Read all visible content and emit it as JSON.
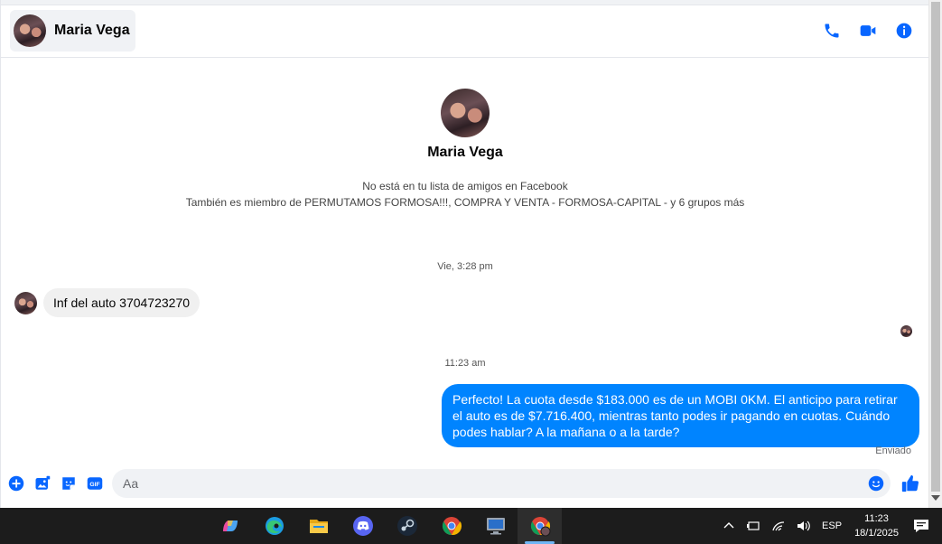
{
  "header": {
    "name": "Maria Vega"
  },
  "profile": {
    "name": "Maria Vega",
    "friend_status": "No está en tu lista de amigos en Facebook",
    "groups": "También es miembro de PERMUTAMOS FORMOSA!!!, COMPRA Y VENTA - FORMOSA-CAPITAL - y 6 grupos más"
  },
  "thread": {
    "timestamp_1": "Vie, 3:28 pm",
    "incoming_message": "Inf del auto 3704723270",
    "timestamp_2": "11:23 am",
    "outgoing_message": "Perfecto! La cuota desde $183.000 es de un MOBI 0KM. El anticipo para retirar el auto es de $7.716.400, mientras tanto podes ir pagando en cuotas. Cuándo podes hablar? A la mañana o a la tarde?",
    "status": "Enviado"
  },
  "composer": {
    "placeholder": "Aa"
  },
  "taskbar": {
    "apps": [
      "copilot-icon",
      "edge-icon",
      "file-explorer-icon",
      "discord-icon",
      "steam-icon",
      "chrome-icon",
      "remote-desktop-icon",
      "chrome-profile-icon"
    ],
    "language": "ESP",
    "time": "11:23",
    "date": "18/1/2025"
  },
  "colors": {
    "accent": "#0084ff",
    "icon_blue": "#0866ff",
    "incoming_bubble": "#f0f0f0",
    "taskbar": "#1c1c1c"
  }
}
